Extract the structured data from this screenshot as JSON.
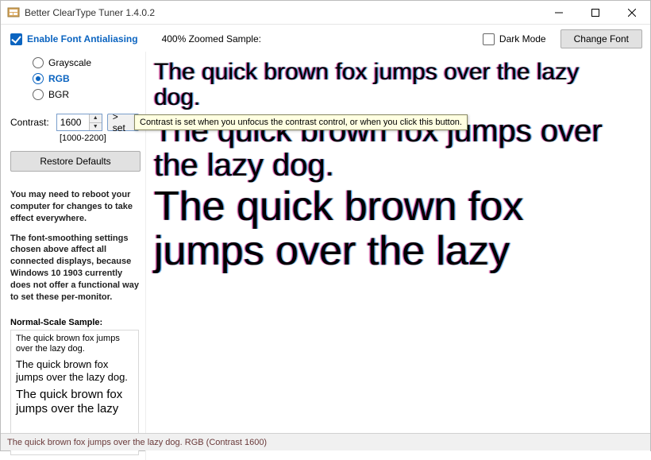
{
  "window": {
    "title": "Better ClearType Tuner 1.4.0.2"
  },
  "toolbar": {
    "enable_aa_label": "Enable Font Antialiasing",
    "enable_aa_checked": true,
    "zoom_label": "400% Zoomed Sample:",
    "dark_mode_label": "Dark Mode",
    "dark_mode_checked": false,
    "change_font_label": "Change Font"
  },
  "sidebar": {
    "rendering_options": [
      {
        "label": "Grayscale",
        "selected": false
      },
      {
        "label": "RGB",
        "selected": true
      },
      {
        "label": "BGR",
        "selected": false
      }
    ],
    "contrast_label": "Contrast:",
    "contrast_value": "1600",
    "contrast_range_hint": "[1000-2200]",
    "set_button_label": "> set",
    "restore_label": "Restore Defaults",
    "info_para1": "You may need to reboot your computer for changes to take effect everywhere.",
    "info_para2": "The font-smoothing settings chosen above affect all connected displays, because Windows 10 1903 currently does not offer a functional way to set these per-monitor.",
    "normal_scale_label": "Normal-Scale Sample:",
    "normal_samples": {
      "s1": "The quick brown fox jumps over the lazy dog.",
      "s2": "The quick brown fox jumps over the lazy dog.",
      "s3": "The quick brown fox jumps over the lazy"
    }
  },
  "preview": {
    "line1": "The quick brown fox jumps over the lazy dog.",
    "line2": "The quick brown fox jumps over the lazy dog.",
    "line3": "The quick brown fox jumps over the lazy"
  },
  "tooltip": {
    "text": "Contrast is set when you unfocus the contrast control, or when you click this button."
  },
  "status": {
    "text": "The quick brown fox jumps over the lazy dog. RGB (Contrast 1600)"
  }
}
